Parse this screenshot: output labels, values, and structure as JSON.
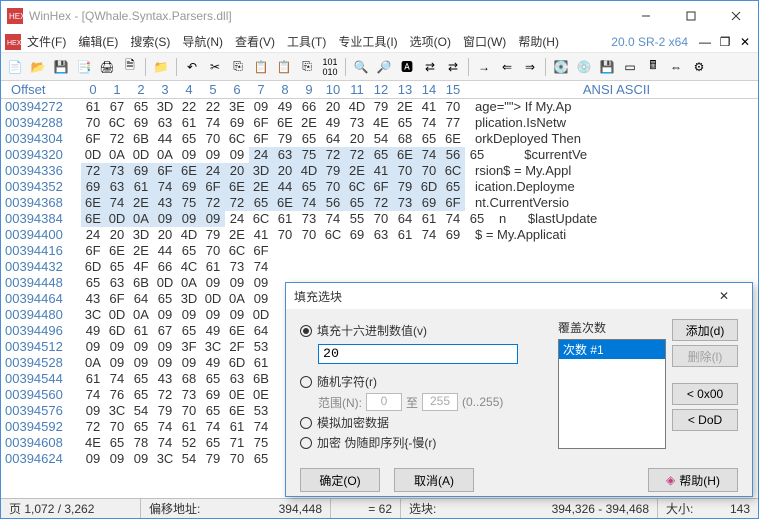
{
  "title": "WinHex - [QWhale.Syntax.Parsers.dll]",
  "version": "20.0 SR-2 x64",
  "menus": [
    "文件(F)",
    "编辑(E)",
    "搜索(S)",
    "导航(N)",
    "查看(V)",
    "工具(T)",
    "专业工具(I)",
    "选项(O)",
    "窗口(W)",
    "帮助(H)"
  ],
  "header": {
    "offset": "Offset",
    "ascii": "ANSI ASCII"
  },
  "bytecols": [
    "0",
    "1",
    "2",
    "3",
    "4",
    "5",
    "6",
    "7",
    "8",
    "9",
    "10",
    "11",
    "12",
    "13",
    "14",
    "15"
  ],
  "rows": [
    {
      "off": "00394272",
      "b": [
        "61",
        "67",
        "65",
        "3D",
        "22",
        "22",
        "3E",
        "09",
        "49",
        "66",
        "20",
        "4D",
        "79",
        "2E",
        "41",
        "70"
      ],
      "a": "age=\"\"> If My.Ap",
      "sel": []
    },
    {
      "off": "00394288",
      "b": [
        "70",
        "6C",
        "69",
        "63",
        "61",
        "74",
        "69",
        "6F",
        "6E",
        "2E",
        "49",
        "73",
        "4E",
        "65",
        "74",
        "77"
      ],
      "a": "plication.IsNetw",
      "sel": []
    },
    {
      "off": "00394304",
      "b": [
        "6F",
        "72",
        "6B",
        "44",
        "65",
        "70",
        "6C",
        "6F",
        "79",
        "65",
        "64",
        "20",
        "54",
        "68",
        "65",
        "6E"
      ],
      "a": "orkDeployed Then",
      "sel": []
    },
    {
      "off": "00394320",
      "b": [
        "0D",
        "0A",
        "0D",
        "0A",
        "09",
        "09",
        "09",
        "24",
        "63",
        "75",
        "72",
        "72",
        "65",
        "6E",
        "74",
        "56",
        "65"
      ],
      "a": "       $currentVe",
      "sel": [
        7,
        8,
        9,
        10,
        11,
        12,
        13,
        14,
        15
      ]
    },
    {
      "off": "00394336",
      "b": [
        "72",
        "73",
        "69",
        "6F",
        "6E",
        "24",
        "20",
        "3D",
        "20",
        "4D",
        "79",
        "2E",
        "41",
        "70",
        "70",
        "6C"
      ],
      "a": "rsion$ = My.Appl",
      "sel": [
        0,
        1,
        2,
        3,
        4,
        5,
        6,
        7,
        8,
        9,
        10,
        11,
        12,
        13,
        14,
        15
      ]
    },
    {
      "off": "00394352",
      "b": [
        "69",
        "63",
        "61",
        "74",
        "69",
        "6F",
        "6E",
        "2E",
        "44",
        "65",
        "70",
        "6C",
        "6F",
        "79",
        "6D",
        "65"
      ],
      "a": "ication.Deployme",
      "sel": [
        0,
        1,
        2,
        3,
        4,
        5,
        6,
        7,
        8,
        9,
        10,
        11,
        12,
        13,
        14,
        15
      ]
    },
    {
      "off": "00394368",
      "b": [
        "6E",
        "74",
        "2E",
        "43",
        "75",
        "72",
        "72",
        "65",
        "6E",
        "74",
        "56",
        "65",
        "72",
        "73",
        "69",
        "6F"
      ],
      "a": "nt.CurrentVersio",
      "sel": [
        0,
        1,
        2,
        3,
        4,
        5,
        6,
        7,
        8,
        9,
        10,
        11,
        12,
        13,
        14,
        15
      ]
    },
    {
      "off": "00394384",
      "b": [
        "6E",
        "0D",
        "0A",
        "09",
        "09",
        "09",
        "24",
        "6C",
        "61",
        "73",
        "74",
        "55",
        "70",
        "64",
        "61",
        "74",
        "65"
      ],
      "a": "n      $lastUpdate",
      "sel": [
        0,
        1,
        2,
        3,
        4,
        5
      ]
    },
    {
      "off": "00394400",
      "b": [
        "24",
        "20",
        "3D",
        "20",
        "4D",
        "79",
        "2E",
        "41",
        "70",
        "70",
        "6C",
        "69",
        "63",
        "61",
        "74",
        "69"
      ],
      "a": "$ = My.Applicati",
      "sel": []
    },
    {
      "off": "00394416",
      "b": [
        "6F",
        "6E",
        "2E",
        "44",
        "65",
        "70",
        "6C",
        "6F"
      ],
      "a": "",
      "sel": []
    },
    {
      "off": "00394432",
      "b": [
        "6D",
        "65",
        "4F",
        "66",
        "4C",
        "61",
        "73",
        "74"
      ],
      "a": "",
      "sel": []
    },
    {
      "off": "00394448",
      "b": [
        "65",
        "63",
        "6B",
        "0D",
        "0A",
        "09",
        "09",
        "09"
      ],
      "a": "",
      "sel": []
    },
    {
      "off": "00394464",
      "b": [
        "43",
        "6F",
        "64",
        "65",
        "3D",
        "0D",
        "0A",
        "09"
      ],
      "a": "",
      "sel": []
    },
    {
      "off": "00394480",
      "b": [
        "3C",
        "0D",
        "0A",
        "09",
        "09",
        "09",
        "09",
        "0D"
      ],
      "a": "",
      "sel": []
    },
    {
      "off": "00394496",
      "b": [
        "49",
        "6D",
        "61",
        "67",
        "65",
        "49",
        "6E",
        "64"
      ],
      "a": "",
      "sel": []
    },
    {
      "off": "00394512",
      "b": [
        "09",
        "09",
        "09",
        "09",
        "3F",
        "3C",
        "2F",
        "53"
      ],
      "a": "",
      "sel": []
    },
    {
      "off": "00394528",
      "b": [
        "0A",
        "09",
        "09",
        "09",
        "09",
        "49",
        "6D",
        "61"
      ],
      "a": "",
      "sel": []
    },
    {
      "off": "00394544",
      "b": [
        "61",
        "74",
        "65",
        "43",
        "68",
        "65",
        "63",
        "6B"
      ],
      "a": "",
      "sel": []
    },
    {
      "off": "00394560",
      "b": [
        "74",
        "76",
        "65",
        "72",
        "73",
        "69",
        "0E",
        "0E"
      ],
      "a": "",
      "sel": []
    },
    {
      "off": "00394576",
      "b": [
        "09",
        "3C",
        "54",
        "79",
        "70",
        "65",
        "6E",
        "53"
      ],
      "a": "",
      "sel": []
    },
    {
      "off": "00394592",
      "b": [
        "72",
        "70",
        "65",
        "74",
        "61",
        "74",
        "61",
        "74"
      ],
      "a": "",
      "sel": []
    },
    {
      "off": "00394608",
      "b": [
        "4E",
        "65",
        "78",
        "74",
        "52",
        "65",
        "71",
        "75"
      ],
      "a": "",
      "sel": []
    },
    {
      "off": "00394624",
      "b": [
        "09",
        "09",
        "09",
        "3C",
        "54",
        "79",
        "70",
        "65"
      ],
      "a": "",
      "sel": []
    }
  ],
  "status": {
    "page": "页 1,072 / 3,262",
    "offsetlabel": "偏移地址:",
    "offsetval": "394,448",
    "eq": "= 62",
    "sellabel": "选块:",
    "selrange": "394,326 - 394,468",
    "sizelabel": "大小:",
    "size": "143"
  },
  "dialog": {
    "title": "填充选块",
    "opt_hex": "填充十六进制数值(v)",
    "hex_value": "20",
    "opt_random": "随机字符(r)",
    "range_label": "范围(N):",
    "range_from": "0",
    "range_to_lbl": "至",
    "range_to": "255",
    "range_hint": "(0..255)",
    "opt_simulate": "模拟加密数据",
    "opt_encrypt": "加密 伪随即序列{-慢(r)",
    "passes_label": "覆盖次数",
    "pass_item": "次数 #1",
    "btn_add": "添加(d)",
    "btn_del": "删除(l)",
    "btn_0x00": "< 0x00",
    "btn_dod": "< DoD",
    "btn_ok": "确定(O)",
    "btn_cancel": "取消(A)",
    "btn_help": "帮助(H)"
  },
  "chart_data": null
}
